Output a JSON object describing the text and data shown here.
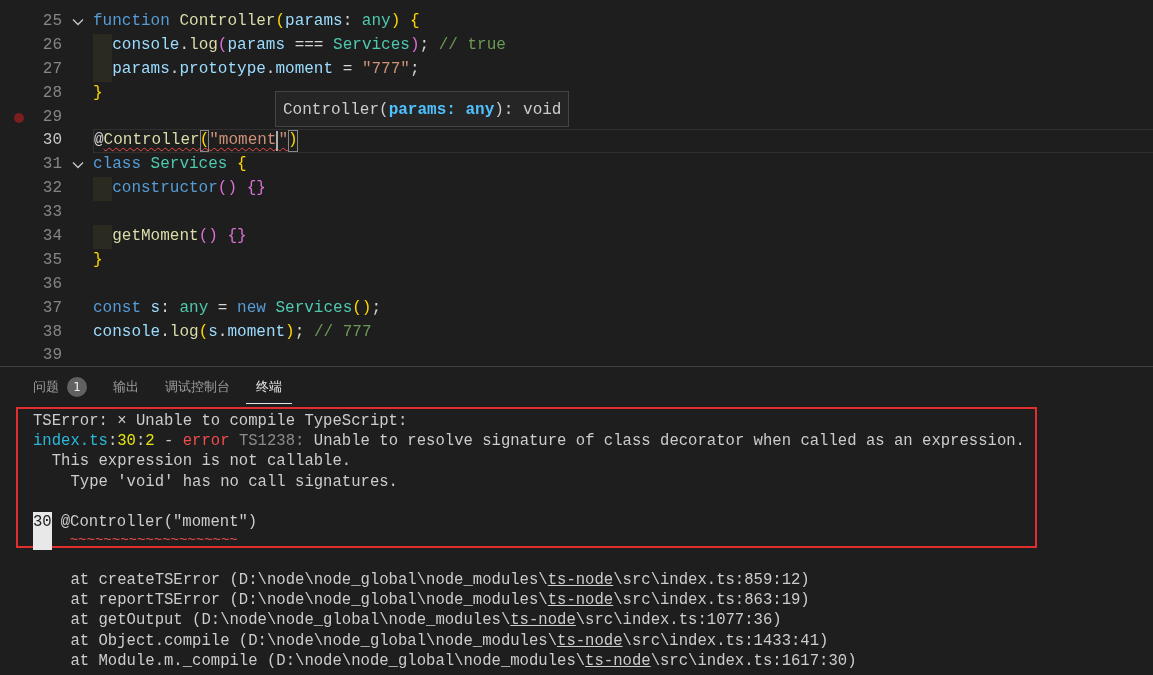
{
  "editor": {
    "lines": [
      {
        "number": "25",
        "fold": true,
        "breakpoint": false,
        "current": false,
        "indented": false,
        "tokens": [
          {
            "kind": "keyword",
            "text": "function "
          },
          {
            "kind": "func",
            "text": "Controller"
          },
          {
            "kind": "brace1",
            "text": "("
          },
          {
            "kind": "param",
            "text": "params"
          },
          {
            "kind": "plain",
            "text": ": "
          },
          {
            "kind": "type",
            "text": "any"
          },
          {
            "kind": "brace1",
            "text": ")"
          },
          {
            "kind": "brace1",
            "text": " {"
          }
        ]
      },
      {
        "number": "26",
        "fold": false,
        "breakpoint": false,
        "current": false,
        "indented": true,
        "tokens": [
          {
            "kind": "param",
            "text": "console"
          },
          {
            "kind": "plain",
            "text": "."
          },
          {
            "kind": "func",
            "text": "log"
          },
          {
            "kind": "brace2",
            "text": "("
          },
          {
            "kind": "param",
            "text": "params"
          },
          {
            "kind": "plain",
            "text": " === "
          },
          {
            "kind": "type",
            "text": "Services"
          },
          {
            "kind": "brace2",
            "text": ")"
          },
          {
            "kind": "plain",
            "text": "; "
          },
          {
            "kind": "comment",
            "text": "// true"
          }
        ]
      },
      {
        "number": "27",
        "fold": false,
        "breakpoint": false,
        "current": false,
        "indented": true,
        "tokens": [
          {
            "kind": "param",
            "text": "params"
          },
          {
            "kind": "plain",
            "text": "."
          },
          {
            "kind": "param",
            "text": "prototype"
          },
          {
            "kind": "plain",
            "text": "."
          },
          {
            "kind": "param",
            "text": "moment"
          },
          {
            "kind": "plain",
            "text": " = "
          },
          {
            "kind": "string",
            "text": "\"777\""
          },
          {
            "kind": "plain",
            "text": ";"
          }
        ]
      },
      {
        "number": "28",
        "fold": false,
        "breakpoint": false,
        "current": false,
        "indented": false,
        "tokens": [
          {
            "kind": "brace1",
            "text": "}"
          }
        ]
      },
      {
        "number": "29",
        "fold": false,
        "breakpoint": true,
        "current": false,
        "indented": false
      },
      {
        "number": "30",
        "fold": false,
        "breakpoint": false,
        "current": true,
        "indented": false,
        "tokens": [
          {
            "kind": "plain",
            "text": "@"
          },
          {
            "kind": "func",
            "text": "Controller",
            "error": true
          },
          {
            "kind": "brace1",
            "text": "(",
            "error": true,
            "matched": true
          },
          {
            "kind": "string",
            "text": "\"moment",
            "error": true
          },
          {
            "kind": "caret"
          },
          {
            "kind": "string",
            "text": "\"",
            "error": true
          },
          {
            "kind": "brace1",
            "text": ")",
            "matched": true
          }
        ]
      },
      {
        "number": "31",
        "fold": true,
        "breakpoint": false,
        "current": false,
        "indented": false,
        "tokens": [
          {
            "kind": "keyword",
            "text": "class "
          },
          {
            "kind": "type",
            "text": "Services"
          },
          {
            "kind": "brace1",
            "text": " {"
          }
        ]
      },
      {
        "number": "32",
        "fold": false,
        "breakpoint": false,
        "current": false,
        "indented": true,
        "tokens": [
          {
            "kind": "keyword",
            "text": "constructor"
          },
          {
            "kind": "brace2",
            "text": "()"
          },
          {
            "kind": "brace2",
            "text": " {}"
          }
        ]
      },
      {
        "number": "33",
        "fold": false,
        "breakpoint": false,
        "current": false,
        "indented": false
      },
      {
        "number": "34",
        "fold": false,
        "breakpoint": false,
        "current": false,
        "indented": true,
        "tokens": [
          {
            "kind": "func",
            "text": "getMoment"
          },
          {
            "kind": "brace2",
            "text": "()"
          },
          {
            "kind": "brace2",
            "text": " {}"
          }
        ]
      },
      {
        "number": "35",
        "fold": false,
        "breakpoint": false,
        "current": false,
        "indented": false,
        "tokens": [
          {
            "kind": "brace1",
            "text": "}"
          }
        ]
      },
      {
        "number": "36",
        "fold": false,
        "breakpoint": false,
        "current": false,
        "indented": false
      },
      {
        "number": "37",
        "fold": false,
        "breakpoint": false,
        "current": false,
        "indented": false,
        "tokens": [
          {
            "kind": "keyword",
            "text": "const "
          },
          {
            "kind": "param",
            "text": "s"
          },
          {
            "kind": "plain",
            "text": ": "
          },
          {
            "kind": "type",
            "text": "any"
          },
          {
            "kind": "plain",
            "text": " = "
          },
          {
            "kind": "keyword",
            "text": "new "
          },
          {
            "kind": "type",
            "text": "Services"
          },
          {
            "kind": "brace1",
            "text": "()"
          },
          {
            "kind": "plain",
            "text": ";"
          }
        ]
      },
      {
        "number": "38",
        "fold": false,
        "breakpoint": false,
        "current": false,
        "indented": false,
        "tokens": [
          {
            "kind": "param",
            "text": "console"
          },
          {
            "kind": "plain",
            "text": "."
          },
          {
            "kind": "func",
            "text": "log"
          },
          {
            "kind": "brace1",
            "text": "("
          },
          {
            "kind": "param",
            "text": "s"
          },
          {
            "kind": "plain",
            "text": "."
          },
          {
            "kind": "param",
            "text": "moment"
          },
          {
            "kind": "brace1",
            "text": ")"
          },
          {
            "kind": "plain",
            "text": "; "
          },
          {
            "kind": "comment",
            "text": "// 777"
          }
        ]
      },
      {
        "number": "39",
        "fold": false,
        "breakpoint": false,
        "current": false,
        "indented": false
      }
    ],
    "hover": [
      {
        "kind": "plain",
        "text": "Controller("
      },
      {
        "kind": "bold",
        "text": "params: any"
      },
      {
        "kind": "plain",
        "text": "): void"
      }
    ]
  },
  "panel_tabs": [
    {
      "label": "问题",
      "badge": "1",
      "selected": false
    },
    {
      "label": "输出",
      "selected": false
    },
    {
      "label": "调试控制台",
      "selected": false
    },
    {
      "label": "终端",
      "selected": true
    }
  ],
  "terminal": {
    "error_block": [
      {
        "kind": "text",
        "segments": [
          {
            "kind": "plain",
            "text": "TSError: × Unable to compile TypeScript:"
          }
        ]
      },
      {
        "kind": "text",
        "segments": [
          {
            "kind": "file",
            "text": "index.ts"
          },
          {
            "kind": "plain",
            "text": ":"
          },
          {
            "kind": "number",
            "text": "30"
          },
          {
            "kind": "plain",
            "text": ":"
          },
          {
            "kind": "number",
            "text": "2"
          },
          {
            "kind": "plain",
            "text": " - "
          },
          {
            "kind": "error",
            "text": "error"
          },
          {
            "kind": "code",
            "text": " TS1238:"
          },
          {
            "kind": "plain",
            "text": " Unable to resolve signature of class decorator when called as an expression."
          }
        ]
      },
      {
        "kind": "text",
        "segments": [
          {
            "kind": "plain",
            "text": "  This expression is not callable."
          }
        ]
      },
      {
        "kind": "text",
        "segments": [
          {
            "kind": "plain",
            "text": "    Type 'void' has no call signatures."
          }
        ]
      },
      {
        "kind": "blank"
      },
      {
        "kind": "source",
        "gutter": "30",
        "code": "@Controller(\"moment\")",
        "marker": "~~~~~~~~~~~~~~~~~~~~"
      }
    ],
    "stack": [
      [
        {
          "kind": "plain",
          "text": "    at createTSError (D:\\node\\node_global\\node_modules\\"
        },
        {
          "kind": "link",
          "text": "ts-node"
        },
        {
          "kind": "plain",
          "text": "\\src\\index.ts:859:12)"
        }
      ],
      [
        {
          "kind": "plain",
          "text": "    at reportTSError (D:\\node\\node_global\\node_modules\\"
        },
        {
          "kind": "link",
          "text": "ts-node"
        },
        {
          "kind": "plain",
          "text": "\\src\\index.ts:863:19)"
        }
      ],
      [
        {
          "kind": "plain",
          "text": "    at getOutput (D:\\node\\node_global\\node_modules\\"
        },
        {
          "kind": "link",
          "text": "ts-node"
        },
        {
          "kind": "plain",
          "text": "\\src\\index.ts:1077:36)"
        }
      ],
      [
        {
          "kind": "plain",
          "text": "    at Object.compile (D:\\node\\node_global\\node_modules\\"
        },
        {
          "kind": "link",
          "text": "ts-node"
        },
        {
          "kind": "plain",
          "text": "\\src\\index.ts:1433:41)"
        }
      ],
      [
        {
          "kind": "plain",
          "text": "    at Module.m._compile (D:\\node\\node_global\\node_modules\\"
        },
        {
          "kind": "link",
          "text": "ts-node"
        },
        {
          "kind": "plain",
          "text": "\\src\\index.ts:1617:30)"
        }
      ]
    ]
  }
}
